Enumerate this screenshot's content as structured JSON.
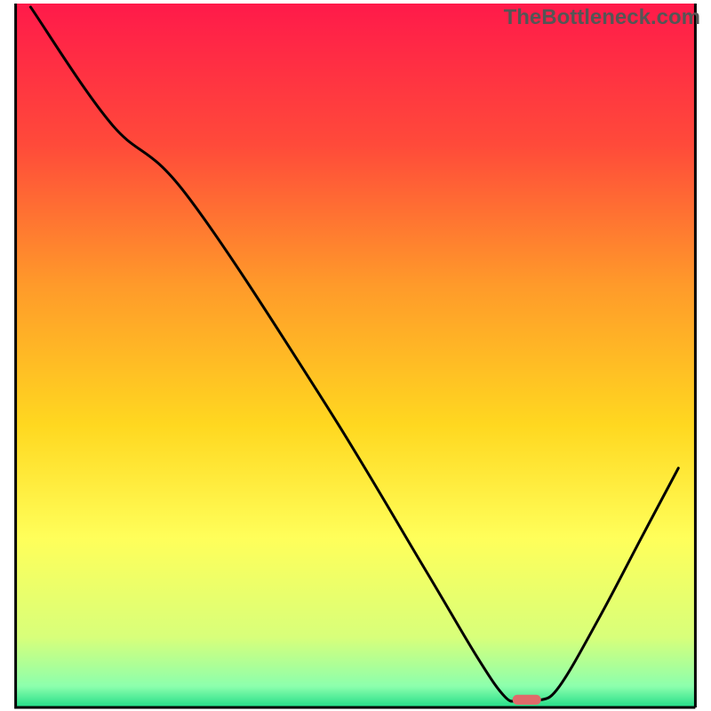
{
  "watermark": "TheBottleneck.com",
  "chart_data": {
    "type": "line",
    "title": "",
    "xlabel": "",
    "ylabel": "",
    "xlim": [
      0,
      100
    ],
    "ylim": [
      0,
      100
    ],
    "gradient_stops": [
      {
        "offset": 0.0,
        "color": "#ff1a4a"
      },
      {
        "offset": 0.2,
        "color": "#ff4a3a"
      },
      {
        "offset": 0.4,
        "color": "#ff9a2a"
      },
      {
        "offset": 0.6,
        "color": "#ffd820"
      },
      {
        "offset": 0.76,
        "color": "#ffff5a"
      },
      {
        "offset": 0.9,
        "color": "#d8ff7a"
      },
      {
        "offset": 0.97,
        "color": "#8cffad"
      },
      {
        "offset": 1.0,
        "color": "#22dd88"
      }
    ],
    "series": [
      {
        "name": "bottleneck-curve",
        "description": "V-shaped bottleneck curve dipping to green band",
        "points": [
          {
            "x": 2.2,
            "y": 99.5
          },
          {
            "x": 14.0,
            "y": 83.0
          },
          {
            "x": 25.0,
            "y": 73.0
          },
          {
            "x": 45.0,
            "y": 44.0
          },
          {
            "x": 60.0,
            "y": 20.0
          },
          {
            "x": 68.0,
            "y": 7.0
          },
          {
            "x": 72.0,
            "y": 1.5
          },
          {
            "x": 74.0,
            "y": 1.0
          },
          {
            "x": 77.0,
            "y": 1.0
          },
          {
            "x": 80.0,
            "y": 3.0
          },
          {
            "x": 86.0,
            "y": 13.0
          },
          {
            "x": 92.0,
            "y": 24.0
          },
          {
            "x": 97.5,
            "y": 34.0
          }
        ]
      }
    ],
    "marker": {
      "description": "red pill-shaped marker at curve minimum",
      "x": 75.2,
      "y": 1.1,
      "width": 4.2,
      "height": 1.4,
      "color": "#e06a6a"
    },
    "axes": {
      "color": "#000000",
      "left_x": 2.2,
      "right_x": 97.8,
      "bottom_y": 0.5,
      "top_y": 99.5
    }
  }
}
